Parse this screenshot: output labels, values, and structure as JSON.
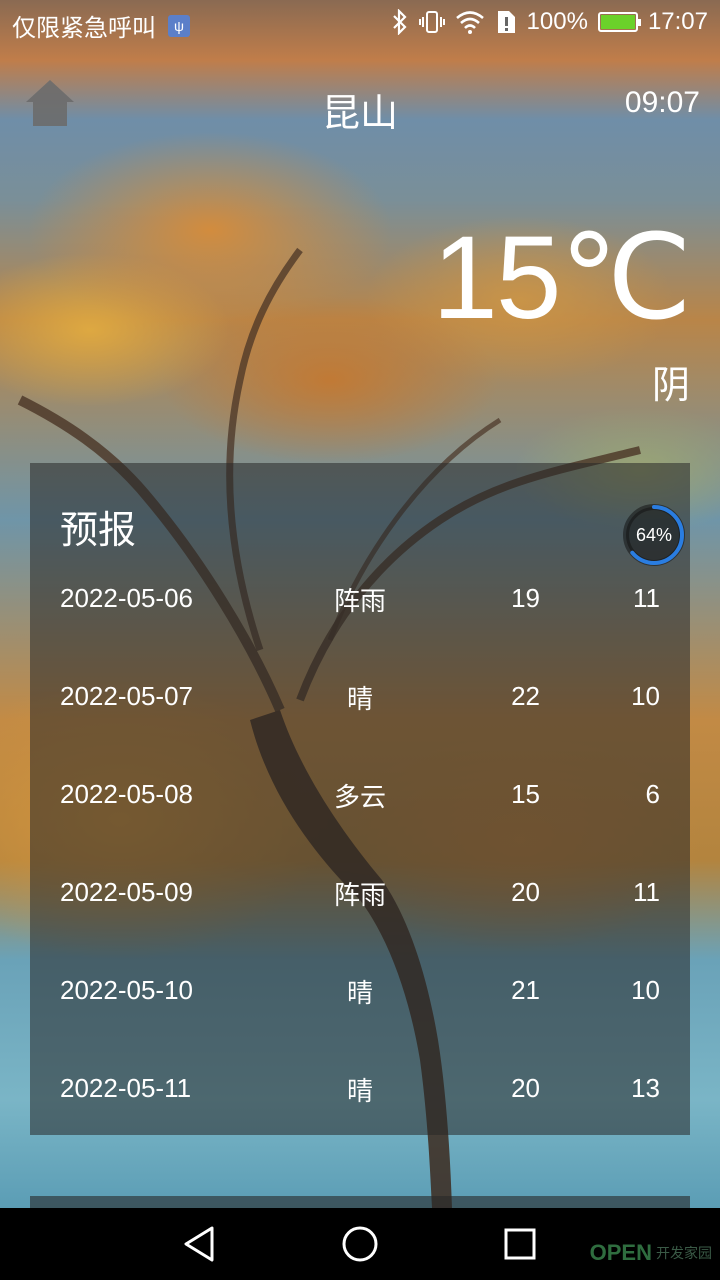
{
  "status_bar": {
    "carrier": "仅限紧急呼叫",
    "usb_icon": "usb-icon",
    "icons": [
      "bluetooth-icon",
      "vibrate-icon",
      "wifi-icon",
      "sim-alert-icon",
      "battery-icon"
    ],
    "battery_percent": "100%",
    "battery_level": 1.0,
    "clock": "17:07"
  },
  "header": {
    "home_icon": "home-icon",
    "city": "昆山",
    "update_time": "09:07"
  },
  "current": {
    "temperature": "15℃",
    "condition": "阴"
  },
  "forecast": {
    "title": "预报",
    "progress_label": "64%",
    "progress_value": 0.64,
    "rows": [
      {
        "date": "2022-05-06",
        "weather": "阵雨",
        "high": "19",
        "low": "11"
      },
      {
        "date": "2022-05-07",
        "weather": "晴",
        "high": "22",
        "low": "10"
      },
      {
        "date": "2022-05-08",
        "weather": "多云",
        "high": "15",
        "low": "6"
      },
      {
        "date": "2022-05-09",
        "weather": "阵雨",
        "high": "20",
        "low": "11"
      },
      {
        "date": "2022-05-10",
        "weather": "晴",
        "high": "21",
        "low": "10"
      },
      {
        "date": "2022-05-11",
        "weather": "晴",
        "high": "20",
        "low": "13"
      }
    ]
  },
  "nav_bar": {
    "buttons": [
      "back-icon",
      "home-circle-icon",
      "recents-icon"
    ]
  },
  "watermark": {
    "logo": "OPEN",
    "text": "开发家园"
  },
  "colors": {
    "accent_ring": "#2a7de1",
    "battery_fill": "#6bd12a",
    "panel": "rgba(40,40,40,0.55)"
  }
}
